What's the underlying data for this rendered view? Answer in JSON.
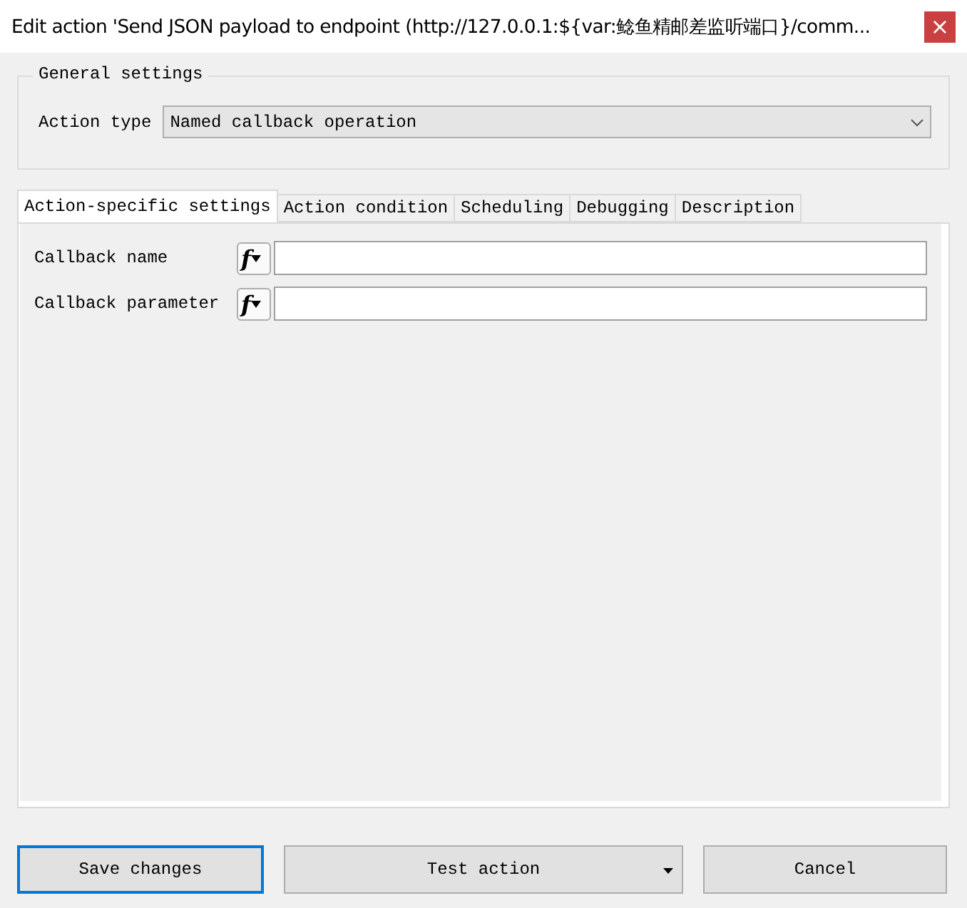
{
  "window": {
    "title": "Edit action 'Send JSON payload to endpoint (http://127.0.0.1:${var:鲶鱼精邮差监听端口}/comm...",
    "close": "×"
  },
  "general": {
    "title": "General settings",
    "action_type_label": "Action type",
    "action_type_value": "Named callback operation"
  },
  "tabs": [
    {
      "label": "Action-specific settings",
      "selected": true
    },
    {
      "label": "Action condition",
      "selected": false
    },
    {
      "label": "Scheduling",
      "selected": false
    },
    {
      "label": "Debugging",
      "selected": false
    },
    {
      "label": "Description",
      "selected": false
    }
  ],
  "fields": [
    {
      "label": "Callback name",
      "function_symbol": "f"
    },
    {
      "label": "Callback parameter",
      "function_symbol": "f"
    }
  ],
  "buttons": [
    {
      "label": "Save changes",
      "kind": "default"
    },
    {
      "label": "Test action",
      "kind": "menu"
    },
    {
      "label": "Cancel",
      "kind": "plain"
    }
  ]
}
